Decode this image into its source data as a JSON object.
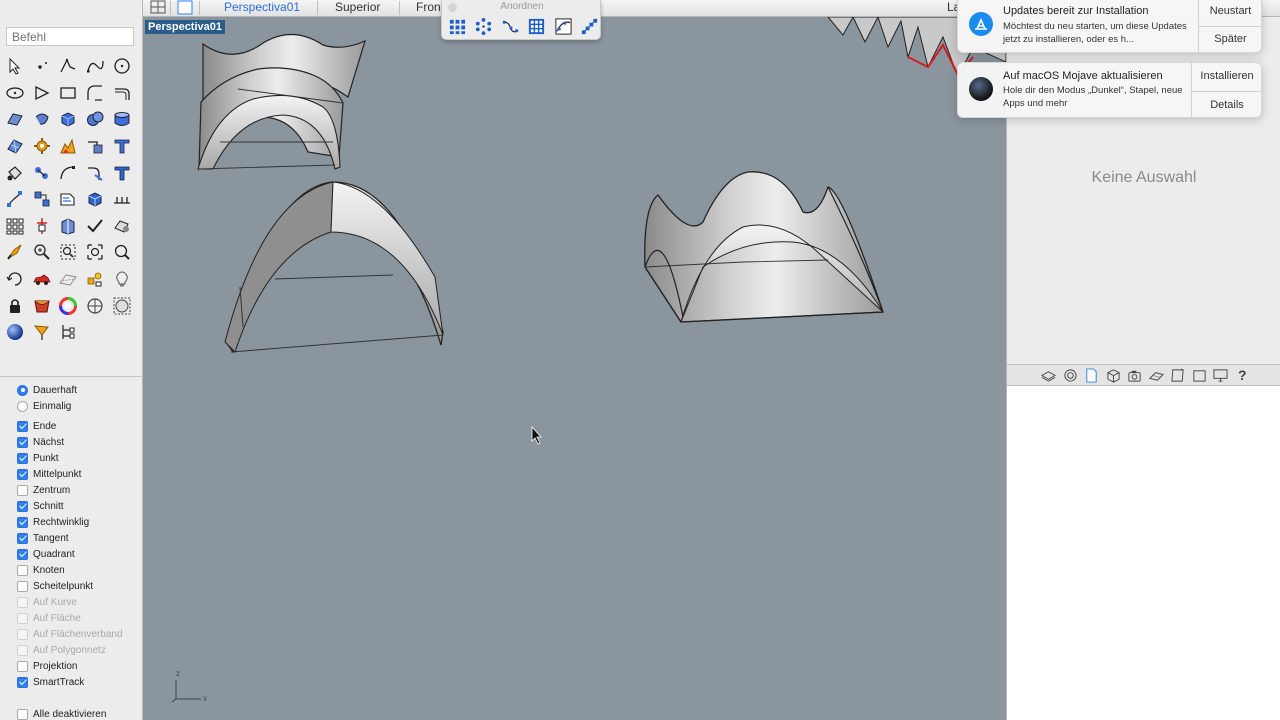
{
  "command": {
    "placeholder": "Befehl"
  },
  "viewport_tabs": [
    "Perspectiva01",
    "Superior",
    "Fron",
    "La"
  ],
  "viewport": {
    "label": "Perspectiva01",
    "axis_x": "x",
    "axis_z": "z"
  },
  "palette": {
    "title": "Anordnen"
  },
  "snap_mode": [
    {
      "label": "Dauerhaft",
      "selected": true
    },
    {
      "label": "Einmalig",
      "selected": false
    }
  ],
  "osnaps": [
    {
      "label": "Ende",
      "checked": true,
      "enabled": true
    },
    {
      "label": "Nächst",
      "checked": true,
      "enabled": true
    },
    {
      "label": "Punkt",
      "checked": true,
      "enabled": true
    },
    {
      "label": "Mittelpunkt",
      "checked": true,
      "enabled": true
    },
    {
      "label": "Zentrum",
      "checked": false,
      "enabled": true
    },
    {
      "label": "Schnitt",
      "checked": true,
      "enabled": true
    },
    {
      "label": "Rechtwinklig",
      "checked": true,
      "enabled": true
    },
    {
      "label": "Tangent",
      "checked": true,
      "enabled": true
    },
    {
      "label": "Quadrant",
      "checked": true,
      "enabled": true
    },
    {
      "label": "Knoten",
      "checked": false,
      "enabled": true
    },
    {
      "label": "Scheitelpunkt",
      "checked": false,
      "enabled": true
    },
    {
      "label": "Auf Kurve",
      "checked": false,
      "enabled": false
    },
    {
      "label": "Auf Fläche",
      "checked": false,
      "enabled": false
    },
    {
      "label": "Auf Flächenverband",
      "checked": false,
      "enabled": false
    },
    {
      "label": "Auf Polygonnetz",
      "checked": false,
      "enabled": false
    },
    {
      "label": "Projektion",
      "checked": false,
      "enabled": true
    },
    {
      "label": "SmartTrack",
      "checked": true,
      "enabled": true
    }
  ],
  "disable_all": {
    "label": "Alle deaktivieren"
  },
  "properties": {
    "empty_text": "Keine Auswahl"
  },
  "notifications": [
    {
      "icon": "app-store-icon",
      "title": "Updates bereit zur Installation",
      "body": "Möchtest du neu starten, um diese Updates jetzt zu installieren, oder es h...",
      "primary": "Neustart",
      "secondary": "Später"
    },
    {
      "icon": "macos-mojave-icon",
      "title": "Auf macOS Mojave aktualisieren",
      "body": "Hole dir den Modus „Dunkel“, Stapel, neue Apps und mehr",
      "primary": "Installieren",
      "secondary": "Details"
    }
  ],
  "colors": {
    "viewport_bg": "#8b959e",
    "accent": "#2f7ff2",
    "label_bg": "#2b5d8a"
  }
}
